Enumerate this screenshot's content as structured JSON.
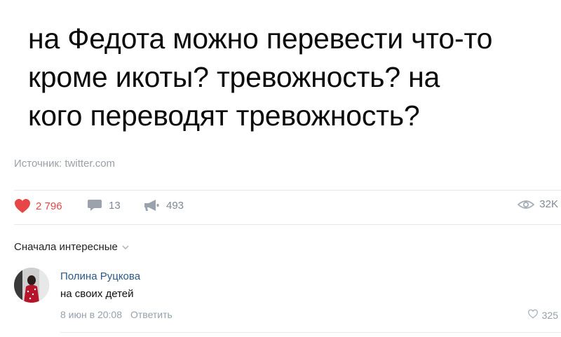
{
  "post": {
    "text": "на Федота можно перевести что-то\nкроме икоты? тревожность? на\nкого переводят тревожность?",
    "source_label": "Источник:",
    "source_link": "twitter.com"
  },
  "actions": {
    "likes": "2 796",
    "comments": "13",
    "reposts": "493",
    "views": "32K"
  },
  "comments_section": {
    "sort_label": "Сначала интересные"
  },
  "comment": {
    "author": "Полина Руцкова",
    "text": "на своих детей",
    "date": "8 июн в 20:08",
    "reply_label": "Ответить",
    "likes": "325"
  },
  "colors": {
    "like_red": "#e64646",
    "link_blue": "#2a5885",
    "muted": "#93a0ae"
  }
}
